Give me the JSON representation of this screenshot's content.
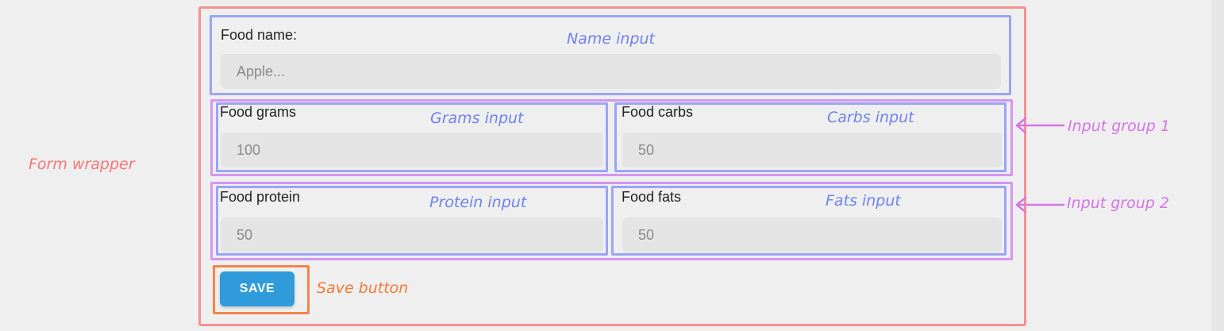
{
  "form": {
    "name_field": {
      "label": "Food name:",
      "placeholder": "Apple..."
    },
    "grams_field": {
      "label": "Food grams",
      "placeholder": "100"
    },
    "carbs_field": {
      "label": "Food carbs",
      "placeholder": "50"
    },
    "protein_field": {
      "label": "Food protein",
      "placeholder": "50"
    },
    "fats_field": {
      "label": "Food fats",
      "placeholder": "50"
    },
    "save_label": "SAVE"
  },
  "annotations": {
    "form_wrapper": "Form wrapper",
    "name_input": "Name input",
    "grams_input": "Grams input",
    "carbs_input": "Carbs input",
    "protein_input": "Protein input",
    "fats_input": "Fats input",
    "input_group_1": "Input group 1",
    "input_group_2": "Input group 2",
    "save_button": "Save button"
  },
  "colors": {
    "form_wrapper_outline": "#f79191",
    "field_outline": "#9ba4f7",
    "group_outline": "#d496f0",
    "save_outline": "#f5834a",
    "save_button_fill": "#2f9bdb"
  },
  "icons": {
    "group_pointer": "arrow-left-icon"
  }
}
